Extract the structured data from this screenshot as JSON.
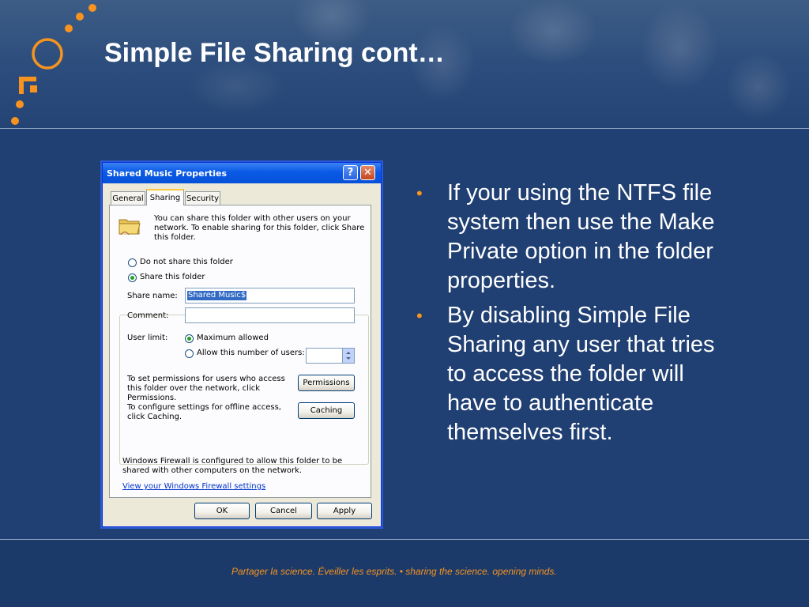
{
  "slide": {
    "title": "Simple File Sharing cont…",
    "bullets": [
      "If your using the NTFS file system then use the Make Private option in the folder properties.",
      "By disabling Simple File Sharing any user that tries to access the folder will have to authenticate themselves first."
    ],
    "footer": "Partager la science. Éveiller les esprits.  •  sharing the science. opening minds.",
    "accent_color": "#f7931e",
    "background_color": "#203f72"
  },
  "dialog": {
    "title": "Shared Music Properties",
    "help_button": "?",
    "close_button": "✕",
    "tabs": [
      "General",
      "Sharing",
      "Security"
    ],
    "intro": "You can share this folder with other users on your network.  To enable sharing for this folder, click Share this folder.",
    "radio_not_share": "Do not share this folder",
    "radio_share": "Share this folder",
    "share_name_label": "Share name:",
    "share_name_value": "Shared Music$",
    "comment_label": "Comment:",
    "comment_value": "",
    "user_limit_label": "User limit:",
    "max_allowed": "Maximum allowed",
    "allow_number": "Allow this number of users:",
    "permissions_text": "To set permissions for users who access this folder over the network, click Permissions.",
    "permissions_button": "Permissions",
    "caching_text": "To configure settings for offline access, click Caching.",
    "caching_button": "Caching",
    "firewall_text": "Windows Firewall is configured to allow this folder to be shared with other computers on the network.",
    "firewall_link": "View your Windows Firewall settings",
    "ok_button": "OK",
    "cancel_button": "Cancel",
    "apply_button": "Apply"
  }
}
